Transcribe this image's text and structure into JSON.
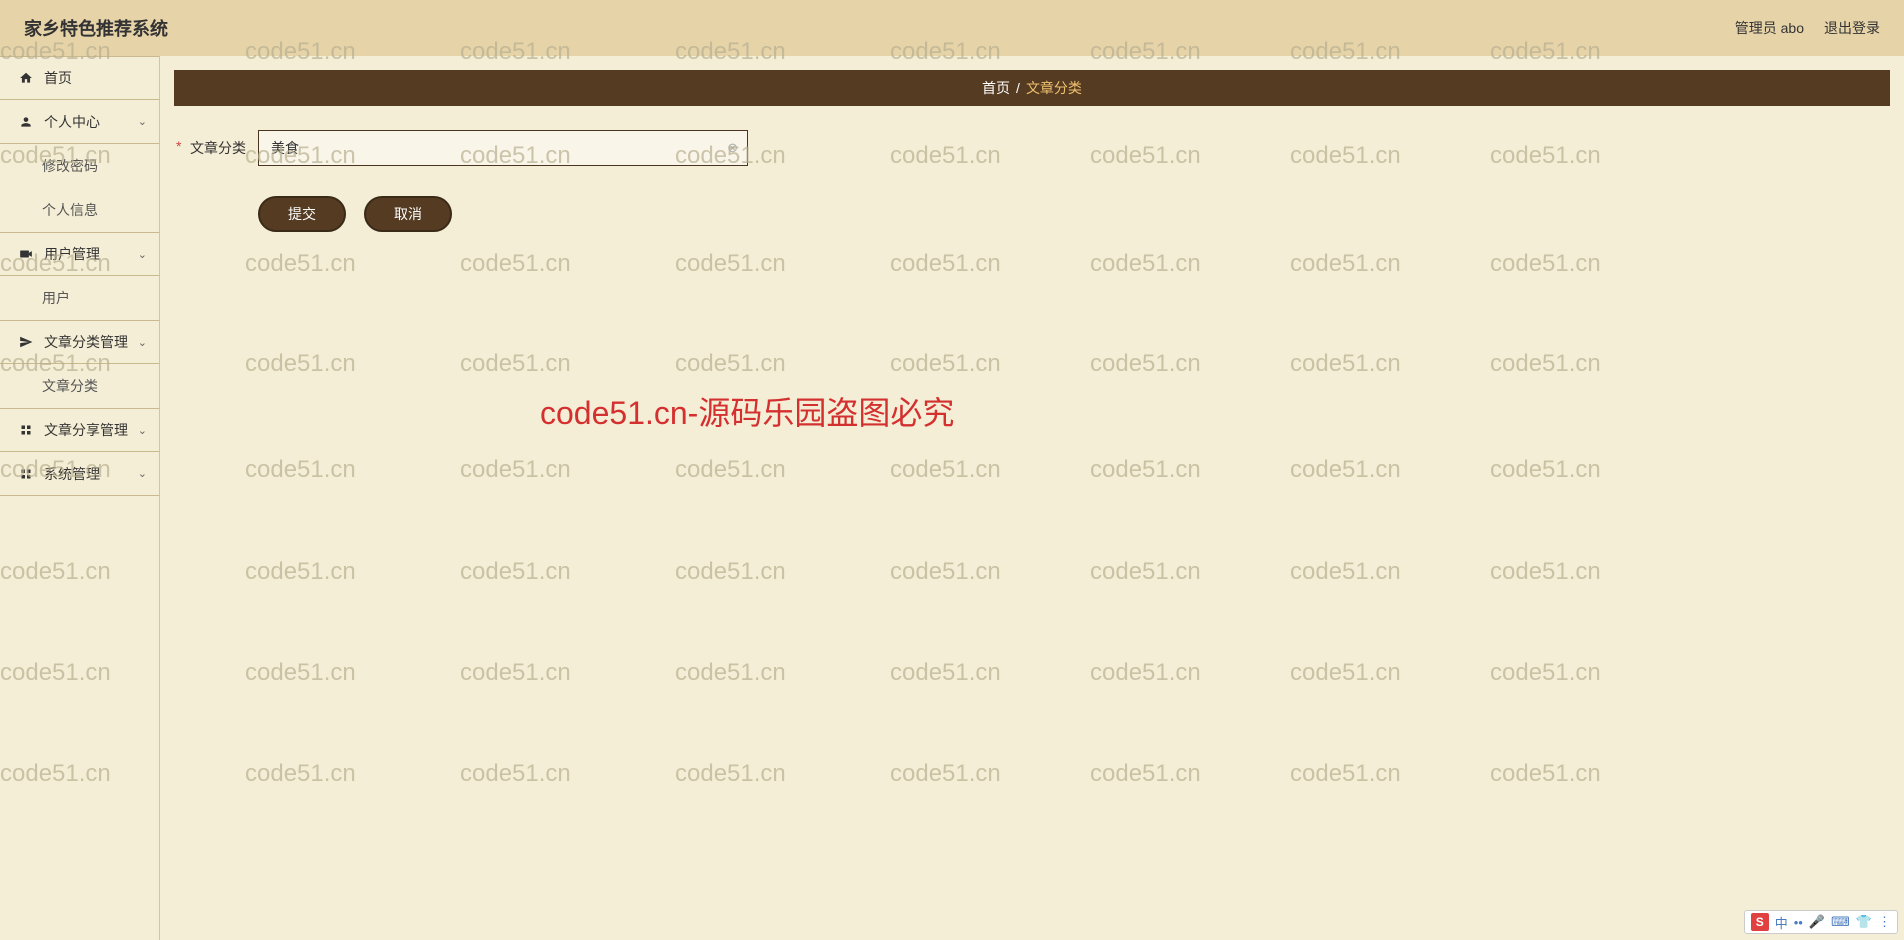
{
  "header": {
    "title": "家乡特色推荐系统",
    "admin_label": "管理员 abo",
    "logout_label": "退出登录"
  },
  "sidebar": {
    "home": "首页",
    "personal": "个人中心",
    "personal_sub": [
      "修改密码",
      "个人信息"
    ],
    "user_mgmt": "用户管理",
    "user_mgmt_sub": [
      "用户"
    ],
    "article_cat_mgmt": "文章分类管理",
    "article_cat_sub": [
      "文章分类"
    ],
    "article_share_mgmt": "文章分享管理",
    "system_mgmt": "系统管理"
  },
  "breadcrumb": {
    "home": "首页",
    "current": "文章分类"
  },
  "form": {
    "label": "文章分类",
    "value": "美食",
    "submit": "提交",
    "cancel": "取消"
  },
  "watermark": {
    "text": "code51.cn",
    "center": "code51.cn-源码乐园盗图必究"
  },
  "ime": {
    "lang": "中"
  }
}
